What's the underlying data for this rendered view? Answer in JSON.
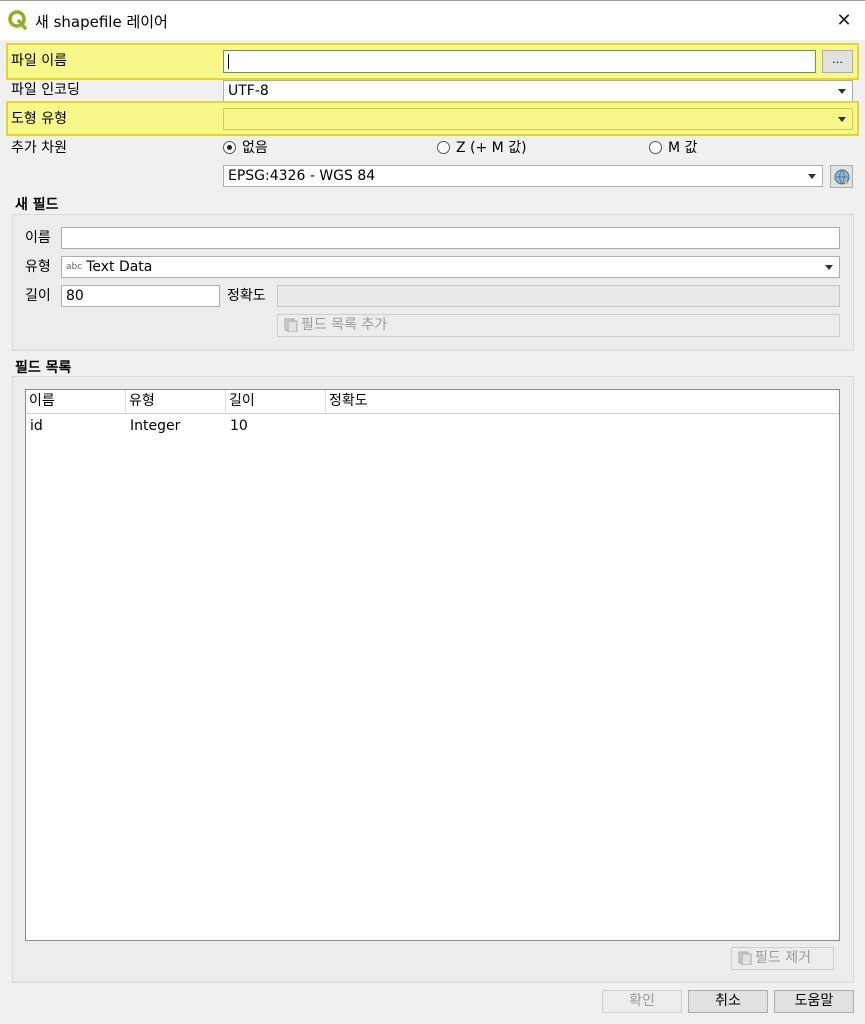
{
  "window": {
    "title": "새 shapefile 레이어",
    "close_glyph": "✕"
  },
  "form": {
    "file_name_label": "파일 이름",
    "file_name_value": "",
    "browse_label": "…",
    "encoding_label": "파일 인코딩",
    "encoding_value": "UTF-8",
    "geometry_label": "도형 유형",
    "geometry_value": "",
    "dimension_label": "추가 차원",
    "dimension_options": [
      "없음",
      "Z (+ M 값)",
      "M 값"
    ],
    "dimension_selected": "없음",
    "crs_value": "EPSG:4326 - WGS 84"
  },
  "new_field": {
    "section_title": "새 필드",
    "name_label": "이름",
    "name_value": "",
    "type_label": "유형",
    "type_icon_text": "abc",
    "type_value": "Text Data",
    "length_label": "길이",
    "length_value": "80",
    "precision_label": "정확도",
    "precision_value": "",
    "add_button": "필드 목록 추가"
  },
  "field_list": {
    "section_title": "필드 목록",
    "columns": [
      "이름",
      "유형",
      "길이",
      "정확도"
    ],
    "rows": [
      {
        "name": "id",
        "type": "Integer",
        "length": "10",
        "precision": ""
      }
    ],
    "remove_button": "필드 제거"
  },
  "footer": {
    "ok_label": "확인",
    "cancel_label": "취소",
    "help_label": "도움말"
  },
  "colors": {
    "highlight": "#f7f78a",
    "highlight_border": "#e0d832",
    "qgis_green": "#93b023"
  }
}
